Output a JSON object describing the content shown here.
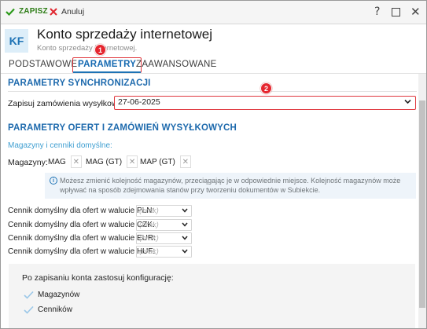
{
  "toolbar": {
    "save_label": "ZAPISZ",
    "cancel_label": "Anuluj",
    "help_glyph": "?",
    "close_glyph": "✕"
  },
  "header": {
    "avatar_initials": "KF",
    "title": "Konto sprzedaży internetowej",
    "subtitle": "Konto sprzedaży internetowej."
  },
  "tabs": [
    {
      "label": "PODSTAWOWE"
    },
    {
      "label": "PARAMETRY",
      "active": true
    },
    {
      "label": "ZAAWANSOWANE"
    }
  ],
  "markers": [
    "1",
    "2"
  ],
  "sync": {
    "section_title": "PARAMETRY SYNCHRONIZACJI",
    "date_label": "Zapisuj zamówienia wysyłkowe od:",
    "date_value": "27-06-2025"
  },
  "offers": {
    "section_title": "PARAMETRY OFERT I ZAMÓWIEŃ WYSYŁKOWYCH",
    "sub_title": "Magazyny i cenniki domyślne:",
    "warehouses_label": "Magazyny:",
    "warehouses": [
      "MAG",
      "MAG (GT)",
      "MAP (GT)"
    ],
    "info_text": "Możesz zmienić kolejność magazynów, przeciągając je w odpowiednie miejsce. Kolejność magazynów może wpływać na sposób zdejmowania stanów przy tworzeniu dokumentów w Subiekcie.",
    "price_lists": [
      {
        "label": "Cennik domyślny dla ofert w walucie PLN:",
        "value": "(brak)"
      },
      {
        "label": "Cennik domyślny dla ofert w walucie CZK:",
        "value": "(brak)"
      },
      {
        "label": "Cennik domyślny dla ofert w walucie EUR:",
        "value": "(brak)"
      },
      {
        "label": "Cennik domyślny dla ofert w walucie HUF:",
        "value": "(brak)"
      }
    ]
  },
  "config": {
    "title": "Po zapisaniu konta zastosuj konfigurację:",
    "options": [
      {
        "label": "Magazynów",
        "checked": true
      },
      {
        "label": "Cenników",
        "checked": true
      }
    ]
  },
  "colors": {
    "accent": "#1e73b5",
    "highlight": "#e0383e",
    "save_green": "#2d7d16"
  }
}
